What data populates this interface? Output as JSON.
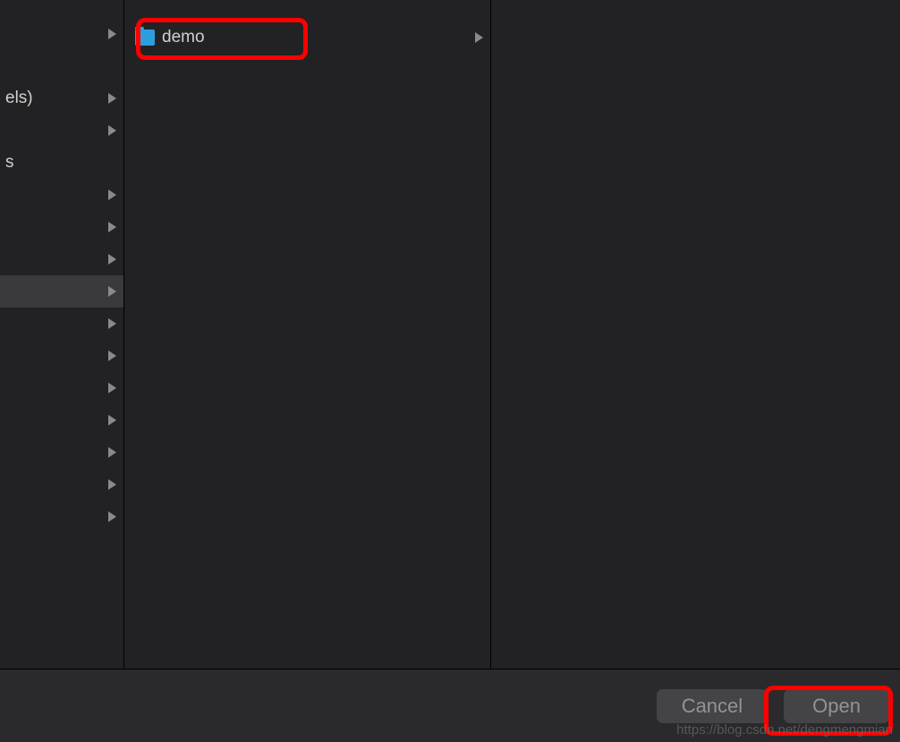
{
  "columns": {
    "first": {
      "items": [
        {
          "label": "",
          "hasArrow": true
        },
        {
          "label": "",
          "hasArrow": false
        },
        {
          "label": "els)",
          "hasArrow": true
        },
        {
          "label": "",
          "hasArrow": true
        },
        {
          "label": "s",
          "hasArrow": false
        },
        {
          "label": "",
          "hasArrow": true
        },
        {
          "label": "",
          "hasArrow": true
        },
        {
          "label": "",
          "hasArrow": true
        },
        {
          "label": "",
          "hasArrow": true,
          "selected": true
        },
        {
          "label": "",
          "hasArrow": true
        },
        {
          "label": "",
          "hasArrow": true
        },
        {
          "label": "",
          "hasArrow": true
        },
        {
          "label": "",
          "hasArrow": true
        },
        {
          "label": "",
          "hasArrow": true
        },
        {
          "label": "",
          "hasArrow": true
        },
        {
          "label": "",
          "hasArrow": true
        }
      ]
    },
    "second": {
      "items": [
        {
          "label": "demo",
          "hasArrow": true,
          "hasFolder": true
        }
      ]
    }
  },
  "footer": {
    "cancel_label": "Cancel",
    "open_label": "Open"
  },
  "watermark": "https://blog.csdn.net/dengmengmian"
}
